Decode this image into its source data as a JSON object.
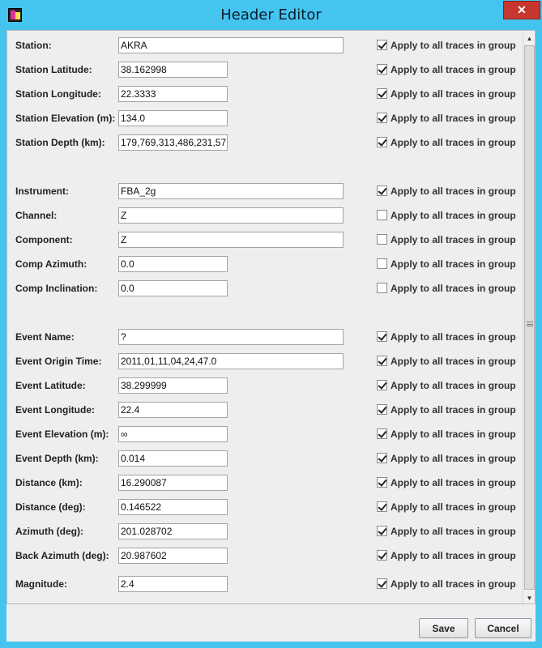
{
  "window": {
    "title": "Header Editor",
    "close_glyph": "✕",
    "app_icon": "seismic-app-icon"
  },
  "apply_label": "Apply to all traces in group",
  "groups": {
    "station": [
      {
        "label": "Station:",
        "value": "AKRA",
        "checked": true
      },
      {
        "label": "Station Latitude:",
        "value": "38.162998",
        "checked": true
      },
      {
        "label": "Station Longitude:",
        "value": "22.3333",
        "checked": true
      },
      {
        "label": "Station Elevation (m):",
        "value": "134.0",
        "checked": true
      },
      {
        "label": "Station Depth (km):",
        "value": "179,769,313,486,231,57",
        "checked": true
      }
    ],
    "instrument": [
      {
        "label": "Instrument:",
        "value": "FBA_2g",
        "checked": true
      },
      {
        "label": "Channel:",
        "value": "Z",
        "checked": false
      },
      {
        "label": "Component:",
        "value": "Z",
        "checked": false
      },
      {
        "label": "Comp Azimuth:",
        "value": "0.0",
        "checked": false
      },
      {
        "label": "Comp Inclination:",
        "value": "0.0",
        "checked": false
      }
    ],
    "event": [
      {
        "label": "Event Name:",
        "value": "?",
        "checked": true
      },
      {
        "label": "Event Origin Time:",
        "value": "2011,01,11,04,24,47.0",
        "checked": true
      },
      {
        "label": "Event Latitude:",
        "value": "38.299999",
        "checked": true
      },
      {
        "label": "Event Longitude:",
        "value": "22.4",
        "checked": true
      },
      {
        "label": "Event Elevation (m):",
        "value": "∞",
        "checked": true
      },
      {
        "label": "Event Depth (km):",
        "value": "0.014",
        "checked": true
      },
      {
        "label": "Distance (km):",
        "value": "16.290087",
        "checked": true
      },
      {
        "label": "Distance (deg):",
        "value": "0.146522",
        "checked": true
      },
      {
        "label": "Azimuth (deg):",
        "value": "201.028702",
        "checked": true
      },
      {
        "label": "Back Azimuth (deg):",
        "value": "20.987602",
        "checked": true
      }
    ],
    "magnitude": [
      {
        "label": "Magnitude:",
        "value": "2.4",
        "checked": true
      }
    ]
  },
  "buttons": {
    "save": "Save",
    "cancel": "Cancel"
  }
}
